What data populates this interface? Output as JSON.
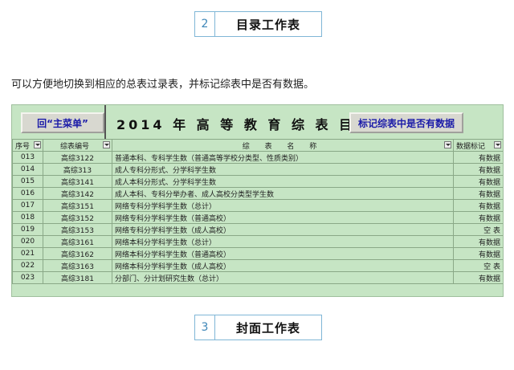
{
  "section2": {
    "number": "2",
    "title": "目录工作表"
  },
  "description": "可以方便地切换到相应的总表过录表，并标记综表中是否有数据。",
  "sheet": {
    "main_menu_button": "回“主菜单”",
    "title": "2014 年 高 等 教 育 综 表 目 录",
    "mark_button": "标记综表中是否有数据",
    "headers": [
      "序号",
      "综表编号",
      "综 表 名 称",
      "数据标记"
    ],
    "rows": [
      {
        "seq": "013",
        "code": "高综3122",
        "name": "普通本科、专科学生数（普通高等学校分类型、性质类别）",
        "flag": "有数据"
      },
      {
        "seq": "014",
        "code": "高综313",
        "name": "成人专科分形式、分学科学生数",
        "flag": "有数据"
      },
      {
        "seq": "015",
        "code": "高综3141",
        "name": "成人本科分形式、分学科学生数",
        "flag": "有数据"
      },
      {
        "seq": "016",
        "code": "高综3142",
        "name": "成人本科、专科分举办者、成人高校分类型学生数",
        "flag": "有数据"
      },
      {
        "seq": "017",
        "code": "高综3151",
        "name": "网络专科分学科学生数（总计）",
        "flag": "有数据"
      },
      {
        "seq": "018",
        "code": "高综3152",
        "name": "网络专科分学科学生数（普通高校）",
        "flag": "有数据"
      },
      {
        "seq": "019",
        "code": "高综3153",
        "name": "网络专科分学科学生数（成人高校）",
        "flag": "空  表"
      },
      {
        "seq": "020",
        "code": "高综3161",
        "name": "网络本科分学科学生数（总计）",
        "flag": "有数据"
      },
      {
        "seq": "021",
        "code": "高综3162",
        "name": "网络本科分学科学生数（普通高校）",
        "flag": "有数据"
      },
      {
        "seq": "022",
        "code": "高综3163",
        "name": "网络本科分学科学生数（成人高校）",
        "flag": "空  表"
      },
      {
        "seq": "023",
        "code": "高综3181",
        "name": "分部门、分计划研究生数（总计）",
        "flag": "有数据"
      }
    ]
  },
  "section3": {
    "number": "3",
    "title": "封面工作表"
  }
}
